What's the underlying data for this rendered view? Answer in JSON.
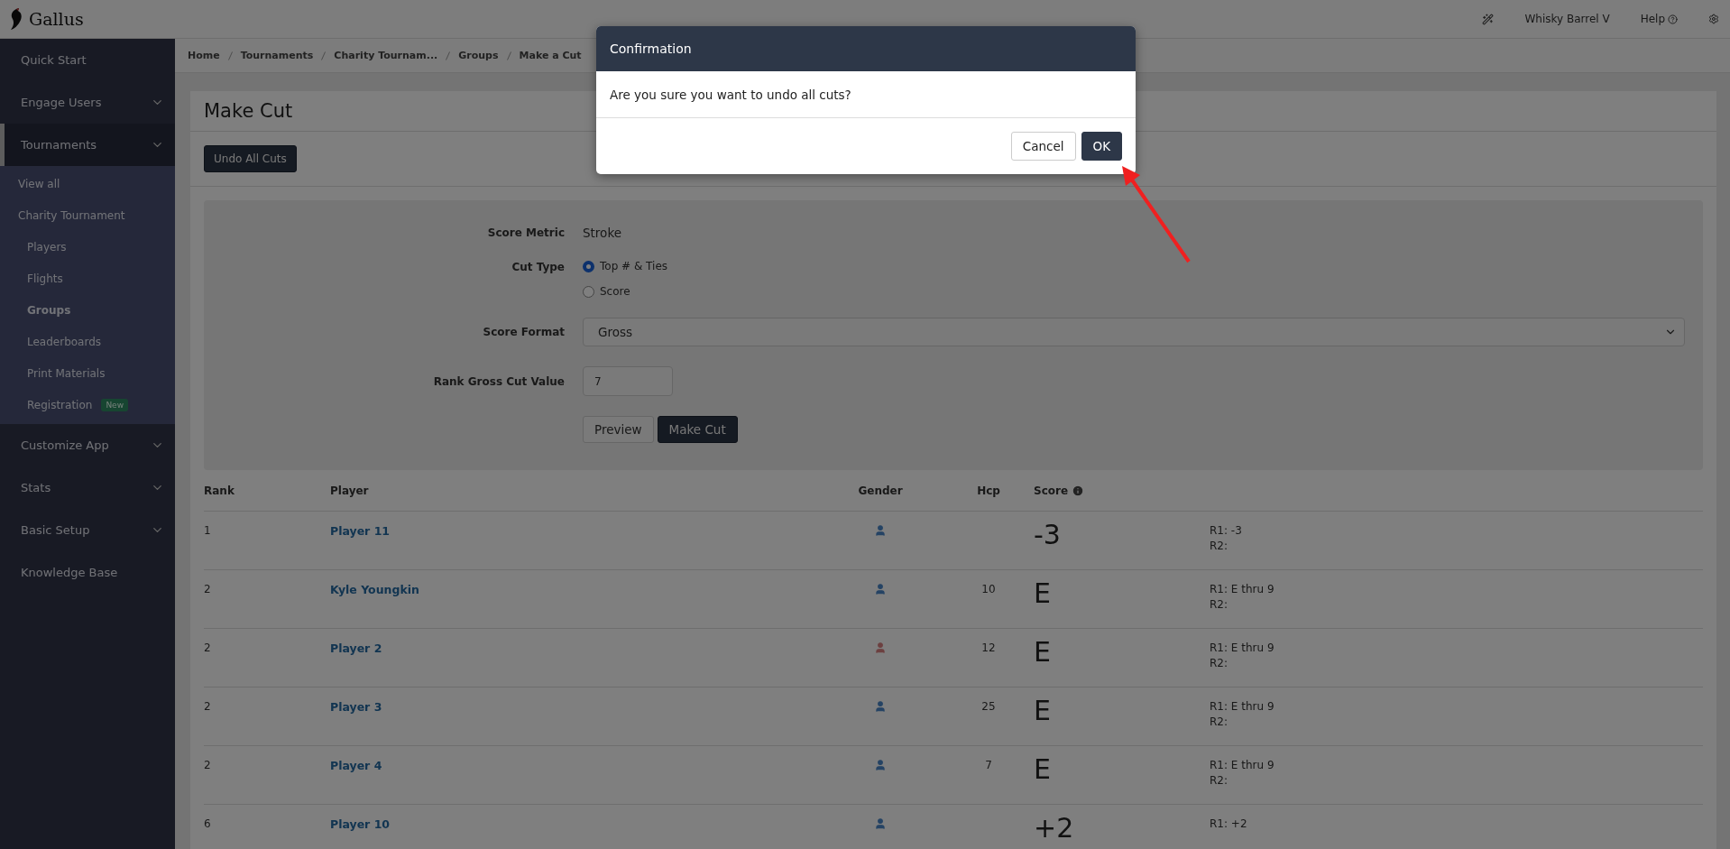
{
  "topbar": {
    "brand": "Gallus",
    "account": "Whisky Barrel V",
    "help": "Help"
  },
  "sidebar": {
    "items": [
      {
        "label": "Quick Start",
        "expandable": false,
        "expanded": false
      },
      {
        "label": "Engage Users",
        "expandable": true,
        "expanded": false
      },
      {
        "label": "Tournaments",
        "expandable": true,
        "expanded": true,
        "children": [
          {
            "label": "View all",
            "selected": false
          },
          {
            "label": "Charity Tournament",
            "selected": false,
            "children": [
              {
                "label": "Players",
                "selected": false
              },
              {
                "label": "Flights",
                "selected": false
              },
              {
                "label": "Groups",
                "selected": true
              },
              {
                "label": "Leaderboards",
                "selected": false
              },
              {
                "label": "Print Materials",
                "selected": false
              },
              {
                "label": "Registration",
                "selected": false,
                "badge": "New"
              }
            ]
          }
        ]
      },
      {
        "label": "Customize App",
        "expandable": true,
        "expanded": false
      },
      {
        "label": "Stats",
        "expandable": true,
        "expanded": false
      },
      {
        "label": "Basic Setup",
        "expandable": true,
        "expanded": false
      },
      {
        "label": "Knowledge Base",
        "expandable": false,
        "expanded": false
      }
    ]
  },
  "breadcrumb": [
    "Home",
    "Tournaments",
    "Charity Tournam...",
    "Groups",
    "Make a Cut"
  ],
  "page": {
    "title": "Make Cut",
    "undo_button": "Undo All Cuts"
  },
  "form": {
    "score_metric": {
      "label": "Score Metric",
      "value": "Stroke"
    },
    "cut_type": {
      "label": "Cut Type",
      "options": [
        {
          "label": "Top # & Ties",
          "selected": true
        },
        {
          "label": "Score",
          "selected": false
        }
      ]
    },
    "score_format": {
      "label": "Score Format",
      "value": "Gross"
    },
    "cut_value": {
      "label": "Rank Gross Cut Value",
      "value": "7"
    },
    "buttons": [
      "Preview",
      "Make Cut"
    ]
  },
  "table": {
    "columns": [
      "Rank",
      "Player",
      "Gender",
      "Hcp",
      "Score"
    ],
    "rows": [
      {
        "rank": "1",
        "player": "Player 11",
        "kind": "male",
        "hcp": "",
        "score": "-3",
        "rounds": [
          "R1: -3",
          "R2:"
        ]
      },
      {
        "rank": "2",
        "player": "Kyle Youngkin",
        "kind": "male",
        "hcp": "10",
        "score": "E",
        "rounds": [
          "R1: E thru 9",
          "R2:"
        ]
      },
      {
        "rank": "2",
        "player": "Player 2",
        "kind": "female",
        "hcp": "12",
        "score": "E",
        "rounds": [
          "R1: E thru 9",
          "R2:"
        ]
      },
      {
        "rank": "2",
        "player": "Player 3",
        "kind": "male",
        "hcp": "25",
        "score": "E",
        "rounds": [
          "R1: E thru 9",
          "R2:"
        ]
      },
      {
        "rank": "2",
        "player": "Player 4",
        "kind": "male",
        "hcp": "7",
        "score": "E",
        "rounds": [
          "R1: E thru 9",
          "R2:"
        ]
      },
      {
        "rank": "6",
        "player": "Player 10",
        "kind": "male",
        "hcp": "",
        "score": "+2",
        "rounds": [
          "R1: +2"
        ]
      }
    ]
  },
  "dialog": {
    "title": "Confirmation",
    "message": "Are you sure you want to undo all cuts?",
    "buttons": [
      {
        "label": "Cancel",
        "kind": "secondary"
      },
      {
        "label": "OK",
        "kind": "primary"
      }
    ]
  }
}
